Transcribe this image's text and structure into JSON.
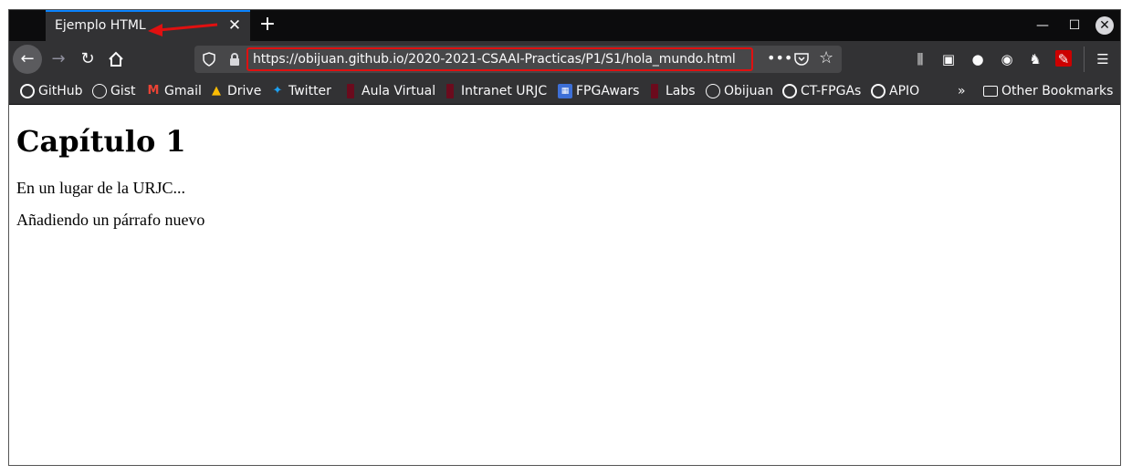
{
  "tab": {
    "title": "Ejemplo HTML",
    "close": "✕"
  },
  "window_controls": {
    "minimize": "—",
    "maximize": "☐",
    "close": "✕"
  },
  "url": "https://obijuan.github.io/2020-2021-CSAAI-Practicas/P1/S1/hola_mundo.html",
  "bookmarks": [
    {
      "label": "GitHub",
      "icon": "github-icon"
    },
    {
      "label": "Gist",
      "icon": "globe-icon"
    },
    {
      "label": "Gmail",
      "icon": "gmail-icon"
    },
    {
      "label": "Drive",
      "icon": "drive-icon"
    },
    {
      "label": "Twitter",
      "icon": "twitter-icon"
    },
    {
      "label": "Aula Virtual",
      "icon": "urjc-icon"
    },
    {
      "label": "Intranet URJC",
      "icon": "urjc-icon"
    },
    {
      "label": "FPGAwars",
      "icon": "fpgawars-icon"
    },
    {
      "label": "Labs",
      "icon": "urjc-icon"
    },
    {
      "label": "Obijuan",
      "icon": "globe-icon"
    },
    {
      "label": "CT-FPGAs",
      "icon": "github-icon"
    },
    {
      "label": "APIO",
      "icon": "github-icon"
    }
  ],
  "other_bookmarks": "Other Bookmarks",
  "page": {
    "heading": "Capítulo 1",
    "paragraphs": [
      "En un lugar de la URJC...",
      "Añadiendo un párrafo nuevo"
    ]
  },
  "colors": {
    "highlight": "#e01010",
    "tab_accent": "#0a84ff",
    "toolbar": "#323234"
  }
}
